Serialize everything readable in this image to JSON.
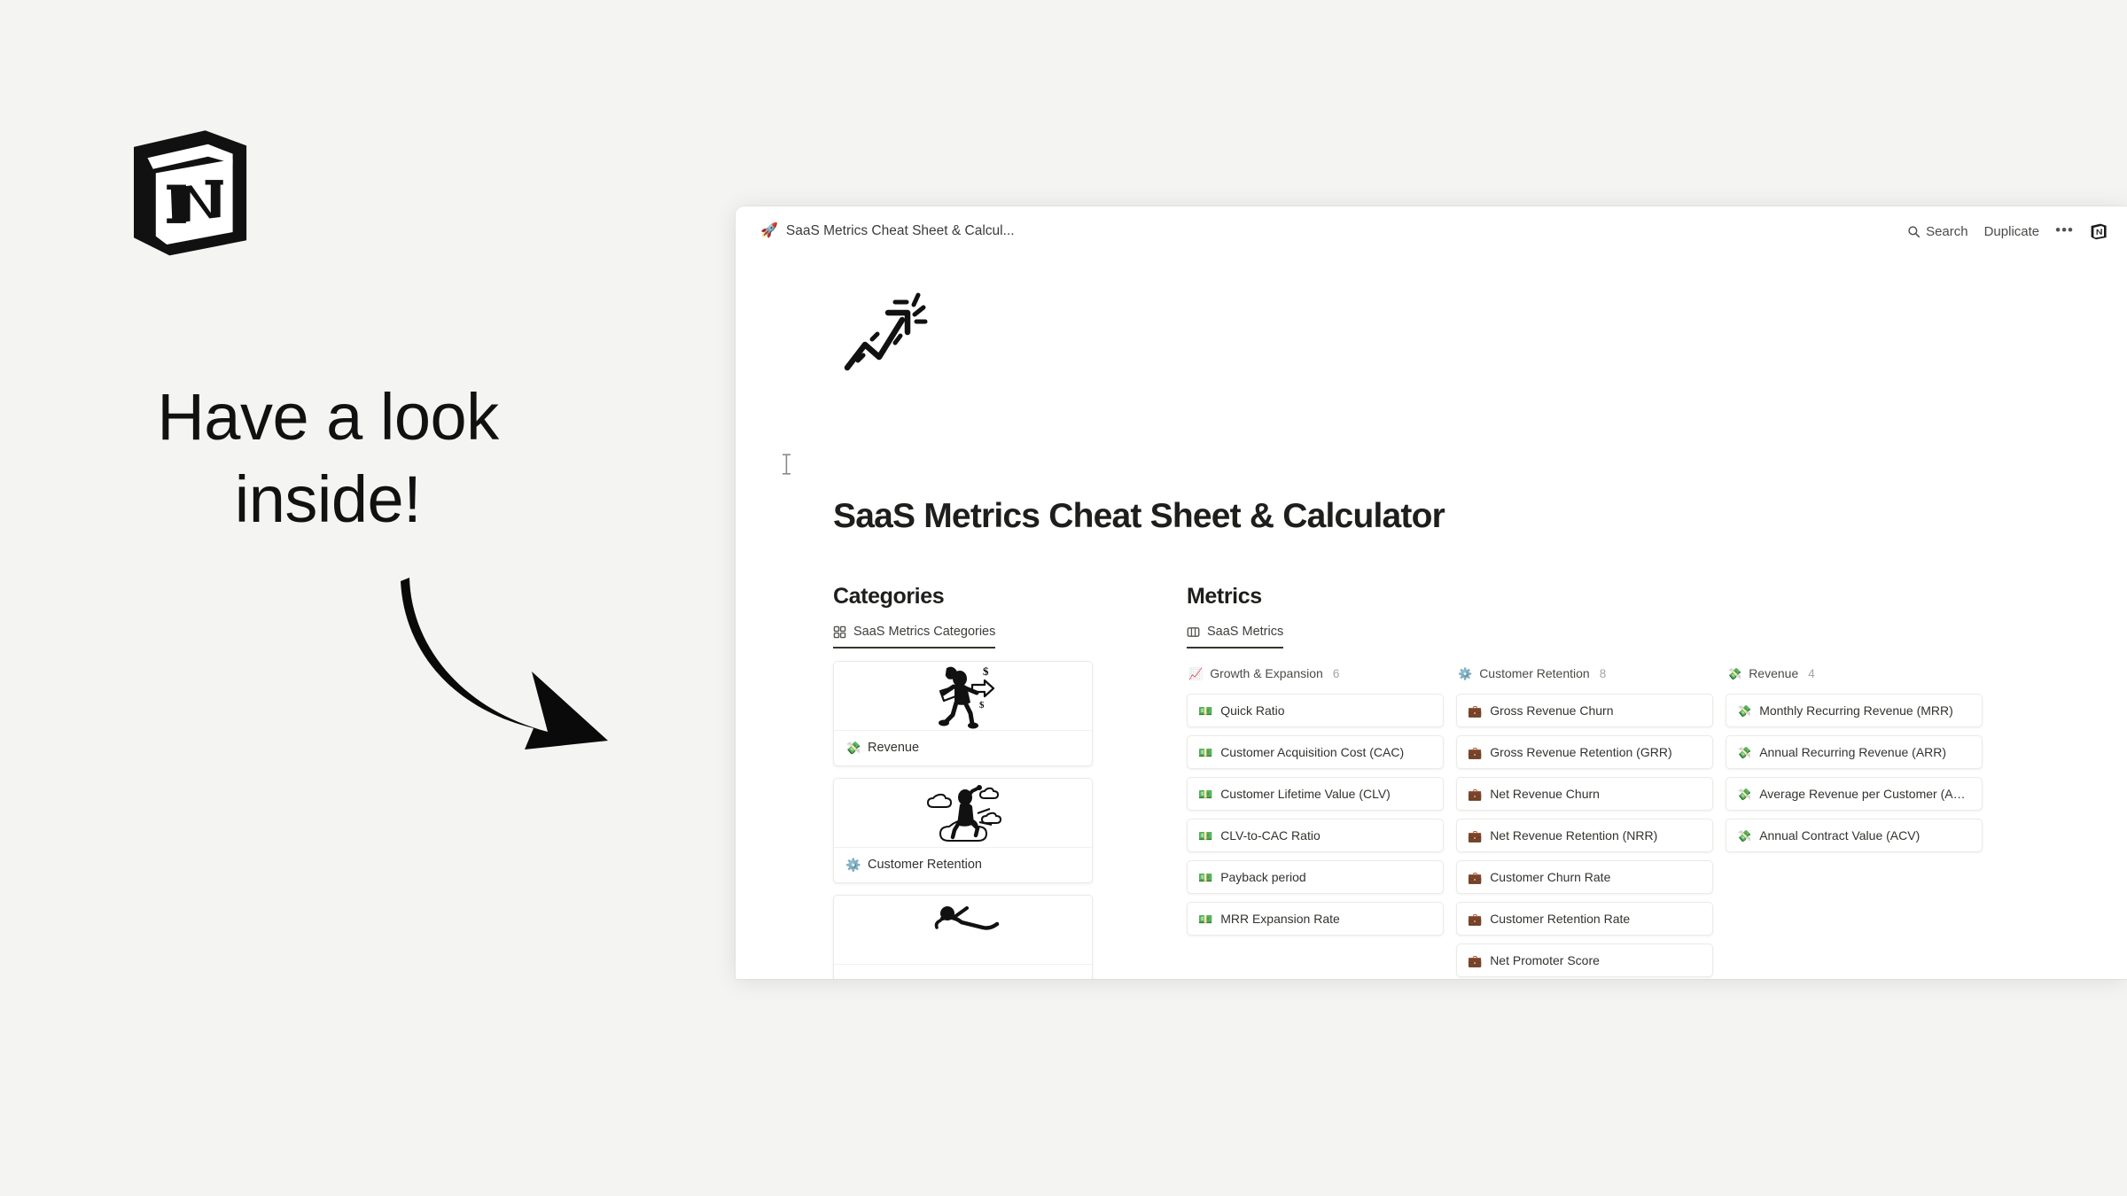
{
  "promo": {
    "logo_icon": "notion-cube-logo",
    "headline_line1": "Have a look",
    "headline_line2": "inside!",
    "arrow_icon": "curved-down-right-arrow-icon"
  },
  "window": {
    "topbar": {
      "breadcrumb_emoji": "rocket-emoji",
      "breadcrumb_title": "SaaS Metrics Cheat Sheet & Calcul...",
      "search_label": "Search",
      "search_icon": "search-icon",
      "duplicate_label": "Duplicate",
      "more_label": "•••",
      "more_icon": "ellipsis-icon",
      "notion_logo_icon": "notion-cube-icon"
    },
    "page": {
      "hero_emoji": "chart-increasing-emoji",
      "title": "SaaS Metrics Cheat Sheet & Calculator",
      "text_cursor_icon": "i-beam-cursor-icon"
    },
    "categories": {
      "heading": "Categories",
      "view_tab_label": "SaaS Metrics Categories",
      "view_tab_icon": "gallery-view-icon",
      "cards": [
        {
          "label": "Revenue",
          "icon": "money-with-wings-emoji",
          "cover_icon": "running-person-with-money-illustration"
        },
        {
          "label": "Customer Retention",
          "icon": "gear-emoji",
          "cover_icon": "person-on-cloud-illustration"
        },
        {
          "label": "",
          "icon": "",
          "cover_icon": "reclining-person-illustration"
        }
      ]
    },
    "metrics": {
      "heading": "Metrics",
      "view_tab_label": "SaaS Metrics",
      "view_tab_icon": "board-view-icon",
      "columns": [
        {
          "name": "Growth & Expansion",
          "emoji": "chart-increasing-emoji",
          "count": "6",
          "cards": [
            {
              "title": "Quick Ratio",
              "icon": "money-banknote-emoji"
            },
            {
              "title": "Customer Acquisition Cost (CAC)",
              "icon": "money-banknote-emoji"
            },
            {
              "title": "Customer Lifetime Value (CLV)",
              "icon": "money-banknote-emoji"
            },
            {
              "title": "CLV-to-CAC Ratio",
              "icon": "money-banknote-emoji"
            },
            {
              "title": "Payback period",
              "icon": "money-banknote-emoji"
            },
            {
              "title": "MRR Expansion Rate",
              "icon": "money-banknote-emoji"
            }
          ]
        },
        {
          "name": "Customer Retention",
          "emoji": "gear-emoji",
          "count": "8",
          "cards": [
            {
              "title": "Gross Revenue Churn",
              "icon": "briefcase-emoji"
            },
            {
              "title": "Gross Revenue Retention (GRR)",
              "icon": "briefcase-emoji"
            },
            {
              "title": "Net Revenue Churn",
              "icon": "briefcase-emoji"
            },
            {
              "title": "Net Revenue Retention (NRR)",
              "icon": "briefcase-emoji"
            },
            {
              "title": "Customer Churn Rate",
              "icon": "briefcase-emoji"
            },
            {
              "title": "Customer Retention Rate",
              "icon": "briefcase-emoji"
            },
            {
              "title": "Net Promoter Score",
              "icon": "briefcase-emoji"
            }
          ]
        },
        {
          "name": "Revenue",
          "emoji": "money-with-wings-emoji",
          "count": "4",
          "cards": [
            {
              "title": "Monthly Recurring Revenue (MRR)",
              "icon": "money-with-wings-emoji"
            },
            {
              "title": "Annual Recurring Revenue (ARR)",
              "icon": "money-with-wings-emoji"
            },
            {
              "title": "Average Revenue per Customer (ARPC)",
              "icon": "money-with-wings-emoji"
            },
            {
              "title": "Annual Contract Value (ACV)",
              "icon": "money-with-wings-emoji"
            }
          ]
        }
      ]
    }
  },
  "colors": {
    "page_background": "#f4f4f2",
    "window_background": "#ffffff",
    "text_primary": "#1e1e1c",
    "text_secondary": "#4b4a46",
    "card_border": "#ebeae7",
    "tab_underline": "#37352f"
  }
}
